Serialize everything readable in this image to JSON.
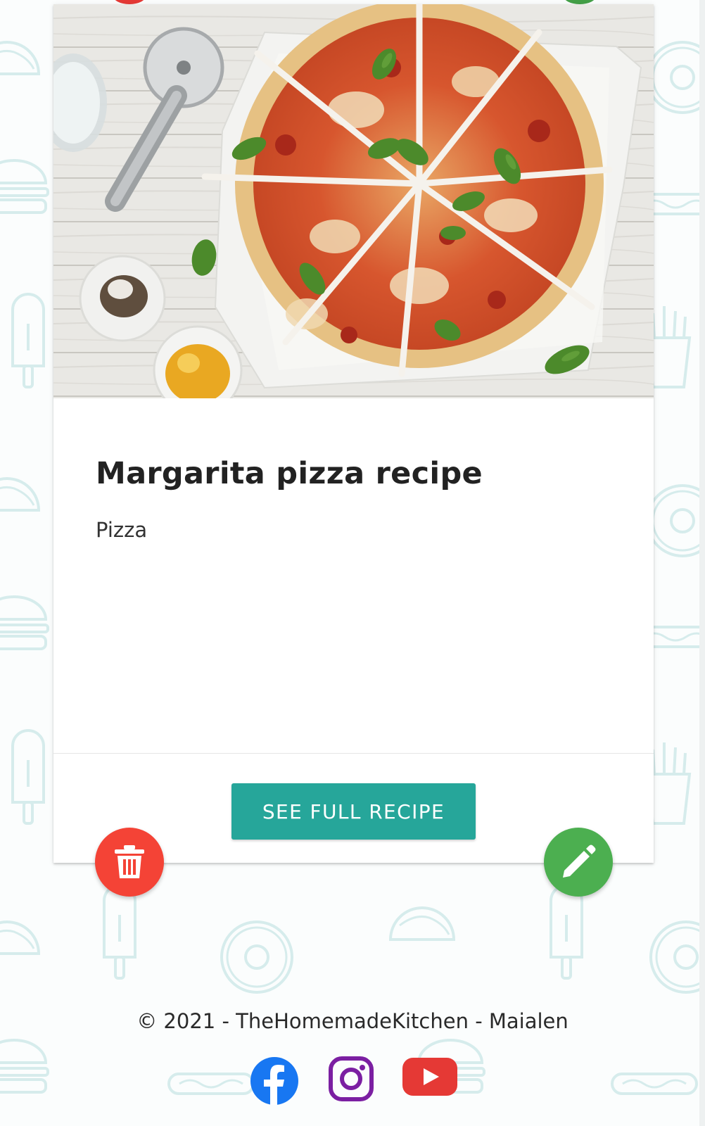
{
  "recipe": {
    "title": "Margarita pizza recipe",
    "category": "Pizza",
    "image_alt": "Sliced margherita pizza with basil on parchment"
  },
  "actions": {
    "see_full_recipe_label": "SEE FULL RECIPE",
    "delete_icon": "trash-icon",
    "edit_icon": "pencil-icon"
  },
  "footer": {
    "copyright": "© 2021 - TheHomemadeKitchen - Maialen"
  },
  "social": [
    {
      "name": "facebook-icon",
      "color": "#1877f2"
    },
    {
      "name": "instagram-icon",
      "color": "#7b1fa2"
    },
    {
      "name": "youtube-icon",
      "color": "#e53935"
    }
  ],
  "colors": {
    "accent_teal": "#26a69a",
    "delete_red": "#f44336",
    "edit_green": "#4caf50",
    "pattern": "#d6ecec"
  }
}
